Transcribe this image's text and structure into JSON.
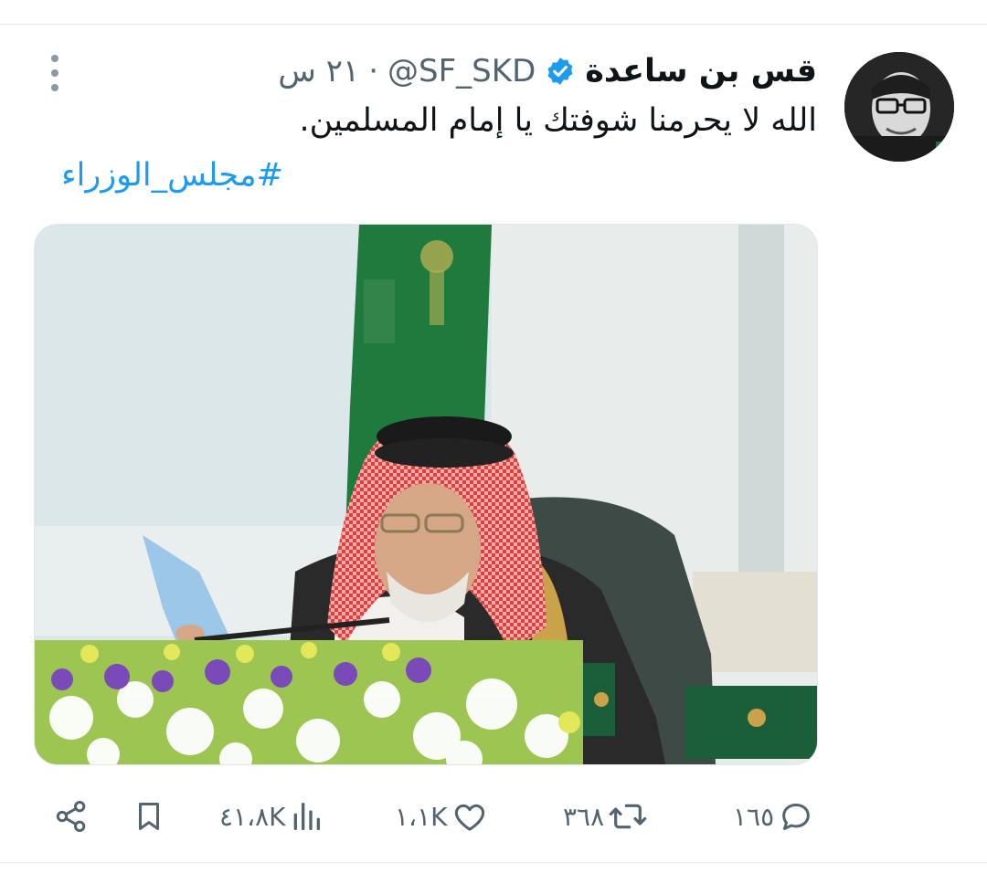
{
  "tweet": {
    "author_name": "قس بن ساعدة",
    "handle": "@SF_SKD",
    "separator": "·",
    "time": "٢١ س",
    "text": "الله لا يحرمنا شوفتك يا إمام المسلمين.",
    "hashtag": "#مجلس_الوزراء"
  },
  "actions": {
    "replies": "١٦٥",
    "retweets": "٣٦٨",
    "likes": "١،١K",
    "views": "٤١،٨K"
  },
  "colors": {
    "accent": "#1d9bf0",
    "text_primary": "#0f1419",
    "text_secondary": "#536471",
    "flag_green": "#1f7a3e"
  },
  "icons": [
    "more-vertical-icon",
    "verified-badge-icon",
    "reply-icon",
    "retweet-icon",
    "like-icon",
    "views-icon",
    "bookmark-icon",
    "share-icon"
  ]
}
